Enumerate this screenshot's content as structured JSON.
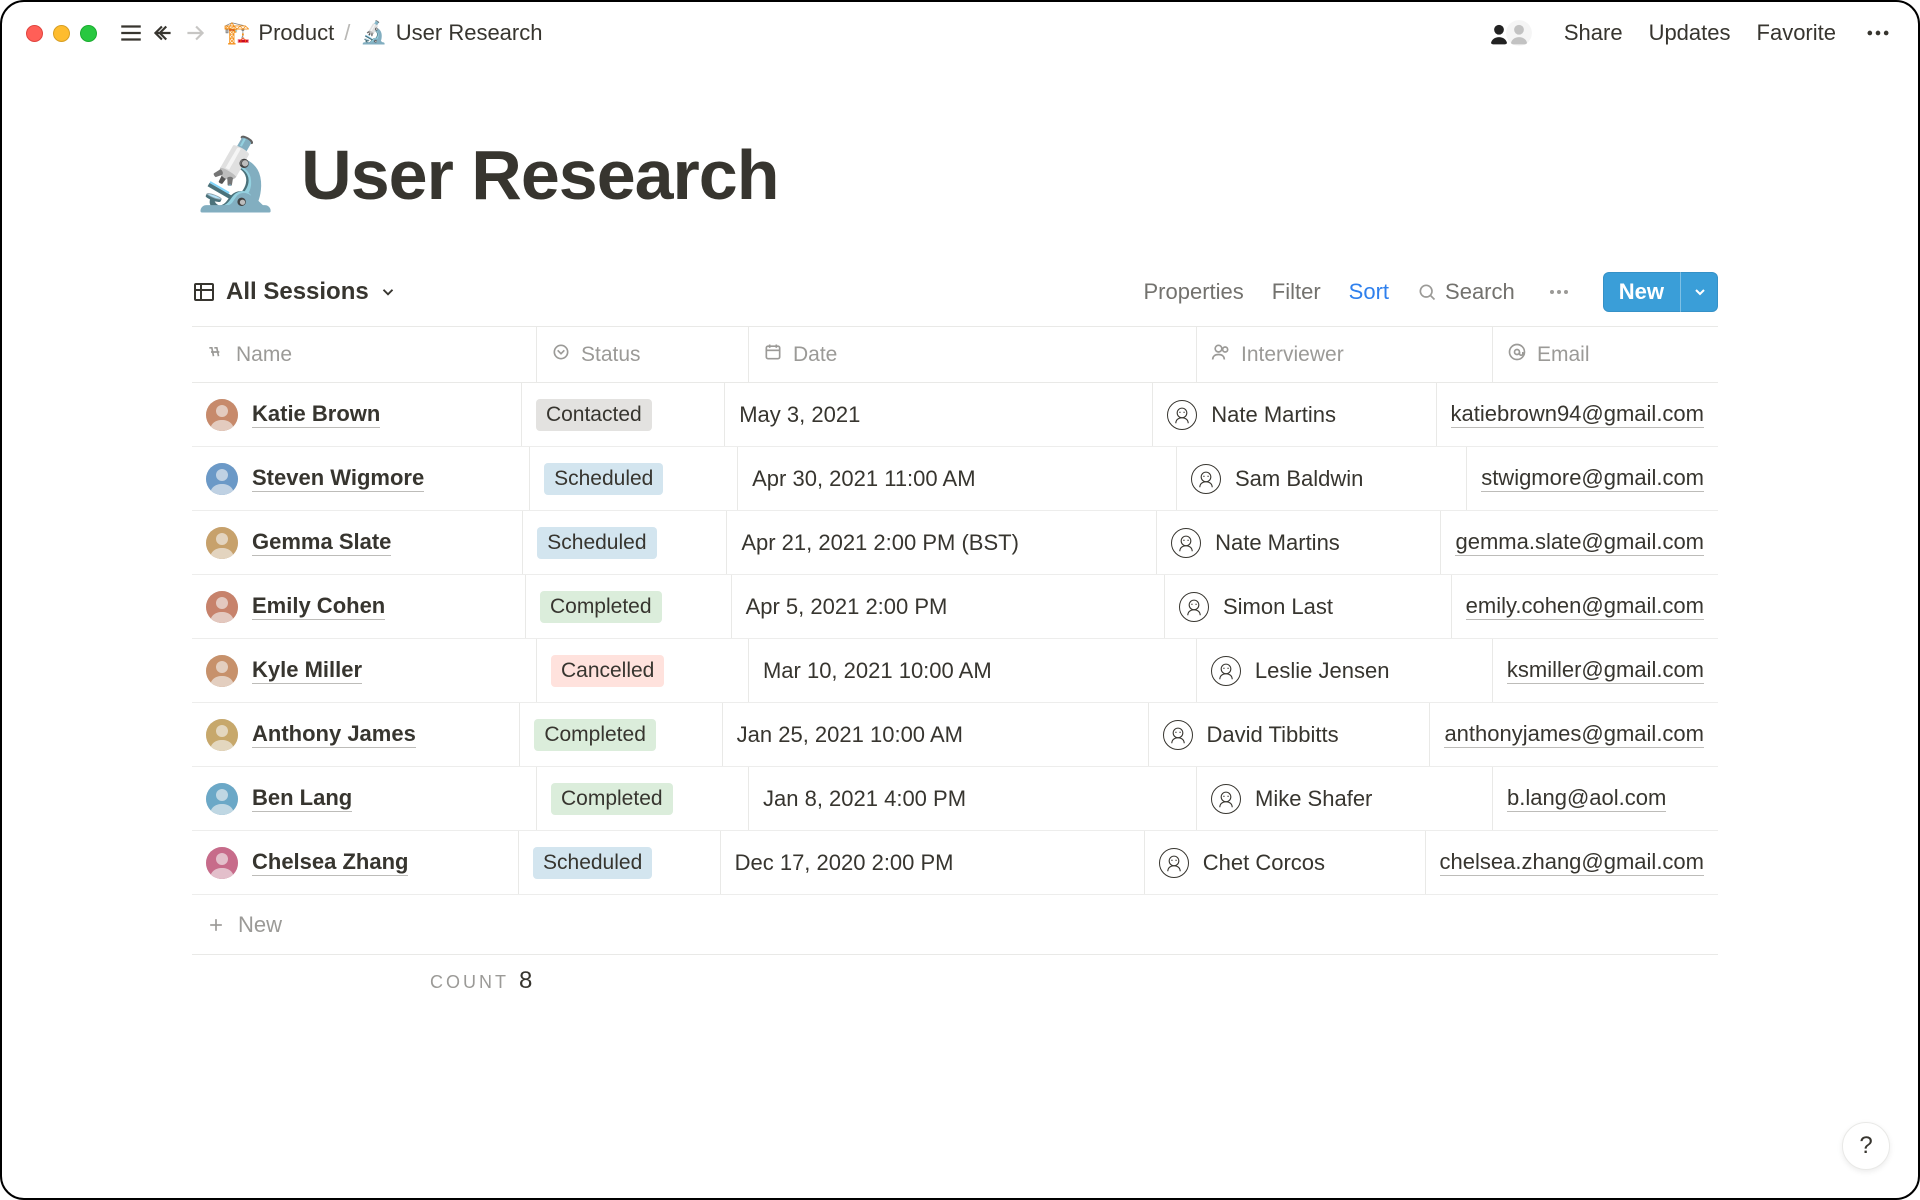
{
  "breadcrumb": {
    "parent_emoji": "🏗️",
    "parent_label": "Product",
    "separator": "/",
    "page_emoji": "🔬",
    "page_label": "User Research"
  },
  "toolbar": {
    "share": "Share",
    "updates": "Updates",
    "favorite": "Favorite"
  },
  "page": {
    "emoji": "🔬",
    "title": "User Research"
  },
  "view": {
    "name": "All Sessions",
    "actions": {
      "properties": "Properties",
      "filter": "Filter",
      "sort": "Sort",
      "search": "Search",
      "new": "New"
    }
  },
  "columns": {
    "name": "Name",
    "status": "Status",
    "date": "Date",
    "interviewer": "Interviewer",
    "email": "Email"
  },
  "status_labels": {
    "contacted": "Contacted",
    "scheduled": "Scheduled",
    "completed": "Completed",
    "cancelled": "Cancelled"
  },
  "rows": [
    {
      "name": "Katie Brown",
      "status": "contacted",
      "date": "May 3, 2021",
      "interviewer": "Nate Martins",
      "email": "katiebrown94@gmail.com",
      "avatar_hue": 20
    },
    {
      "name": "Steven Wigmore",
      "status": "scheduled",
      "date": "Apr 30, 2021 11:00 AM",
      "interviewer": "Sam Baldwin",
      "email": "stwigmore@gmail.com",
      "avatar_hue": 210
    },
    {
      "name": "Gemma Slate",
      "status": "scheduled",
      "date": "Apr 21, 2021 2:00 PM (BST)",
      "interviewer": "Nate Martins",
      "email": "gemma.slate@gmail.com",
      "avatar_hue": 35
    },
    {
      "name": "Emily Cohen",
      "status": "completed",
      "date": "Apr 5, 2021 2:00 PM",
      "interviewer": "Simon Last",
      "email": "emily.cohen@gmail.com",
      "avatar_hue": 15
    },
    {
      "name": "Kyle Miller",
      "status": "cancelled",
      "date": "Mar 10, 2021 10:00 AM",
      "interviewer": "Leslie Jensen",
      "email": "ksmiller@gmail.com",
      "avatar_hue": 25
    },
    {
      "name": "Anthony James",
      "status": "completed",
      "date": "Jan 25, 2021 10:00 AM",
      "interviewer": "David Tibbitts",
      "email": "anthonyjames@gmail.com",
      "avatar_hue": 40
    },
    {
      "name": "Ben Lang",
      "status": "completed",
      "date": "Jan 8, 2021 4:00 PM",
      "interviewer": "Mike Shafer",
      "email": "b.lang@aol.com",
      "avatar_hue": 200
    },
    {
      "name": "Chelsea Zhang",
      "status": "scheduled",
      "date": "Dec 17, 2020 2:00 PM",
      "interviewer": "Chet Corcos",
      "email": "chelsea.zhang@gmail.com",
      "avatar_hue": 340
    }
  ],
  "addrow": "New",
  "footer": {
    "label": "COUNT",
    "value": "8"
  },
  "help": "?"
}
